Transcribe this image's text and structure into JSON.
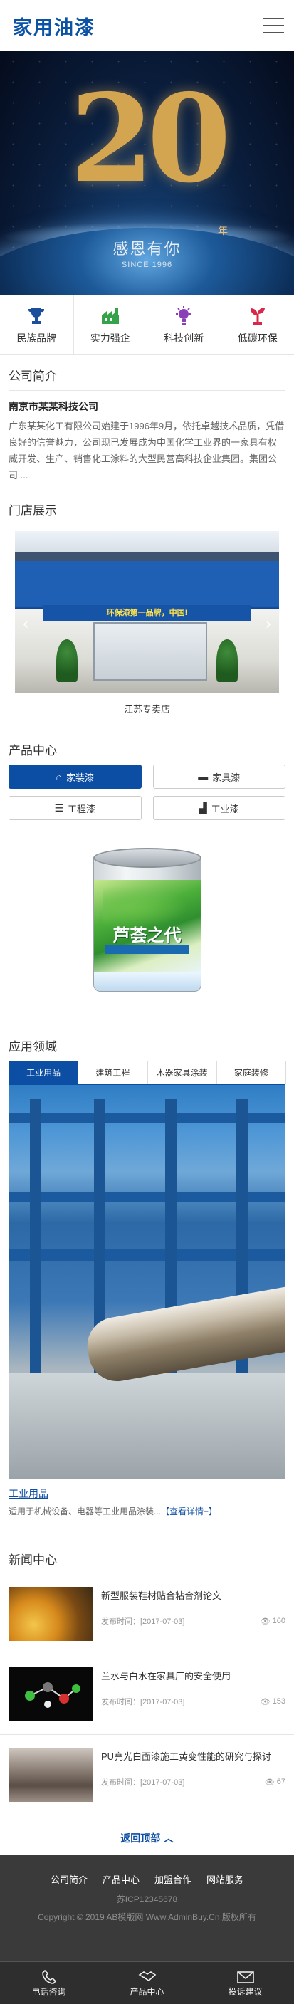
{
  "header": {
    "logo": "家用油漆",
    "menu_icon": "menu-icon"
  },
  "banner": {
    "number": "20",
    "year": "年",
    "slogan": "感恩有你",
    "since": "SINCE 1996"
  },
  "features": [
    {
      "label": "民族品牌",
      "icon": "trophy-icon"
    },
    {
      "label": "实力强企",
      "icon": "factory-icon"
    },
    {
      "label": "科技创新",
      "icon": "bulb-icon"
    },
    {
      "label": "低碳环保",
      "icon": "sprout-icon"
    }
  ],
  "about": {
    "title": "公司简介",
    "company": "南京市某某科技公司",
    "desc": "广东某某化工有限公司始建于1996年9月，依托卓越技术品质，凭借良好的信誉魅力，公司现已发展成为中国化学工业界的一家具有权威开发、生产、销售化工涂料的大型民营高科技企业集团。集团公司 ..."
  },
  "store": {
    "title": "门店展示",
    "sign_text": "环保漆第一品牌，中国!",
    "caption": "江苏专卖店",
    "prev": "‹",
    "next": "›"
  },
  "products": {
    "title": "产品中心",
    "categories": [
      {
        "label": "家装漆",
        "icon": "home-icon",
        "active": true
      },
      {
        "label": "家具漆",
        "icon": "sofa-icon",
        "active": false
      },
      {
        "label": "工程漆",
        "icon": "building-icon",
        "active": false
      },
      {
        "label": "工业漆",
        "icon": "truck-icon",
        "active": false
      }
    ],
    "brand": "芦荟之代"
  },
  "applications": {
    "title": "应用领域",
    "tabs": [
      "工业用品",
      "建筑工程",
      "木器家具涂装",
      "家庭装修"
    ],
    "active_tab": 0,
    "category": "工业用品",
    "desc": "适用于机械设备、电器等工业用品涂装...",
    "more": "【查看详情+】"
  },
  "news": {
    "title": "新闻中心",
    "date_label": "发布时间：",
    "items": [
      {
        "title": "新型服装鞋材贴合粘合剂论文",
        "date": "[2017-07-03]",
        "views": "160"
      },
      {
        "title": "兰水与白水在家具厂的安全使用",
        "date": "[2017-07-03]",
        "views": "153"
      },
      {
        "title": "PU亮光白面漆施工黄变性能的研究与探讨",
        "date": "[2017-07-03]",
        "views": "67"
      }
    ]
  },
  "back_top": "返回顶部",
  "footer": {
    "links": [
      "公司简介",
      "产品中心",
      "加盟合作",
      "网站服务"
    ],
    "icp": "苏ICP12345678",
    "copyright": "Copyright © 2019 AB模版网 Www.AdminBuy.Cn 版权所有"
  },
  "bottom_nav": [
    {
      "label": "电话咨询",
      "icon": "phone-icon"
    },
    {
      "label": "产品中心",
      "icon": "handshake-icon"
    },
    {
      "label": "投诉建议",
      "icon": "mail-icon"
    }
  ],
  "colors": {
    "brand_blue": "#0c4ea3",
    "footer_bg": "#3a3a3a"
  }
}
